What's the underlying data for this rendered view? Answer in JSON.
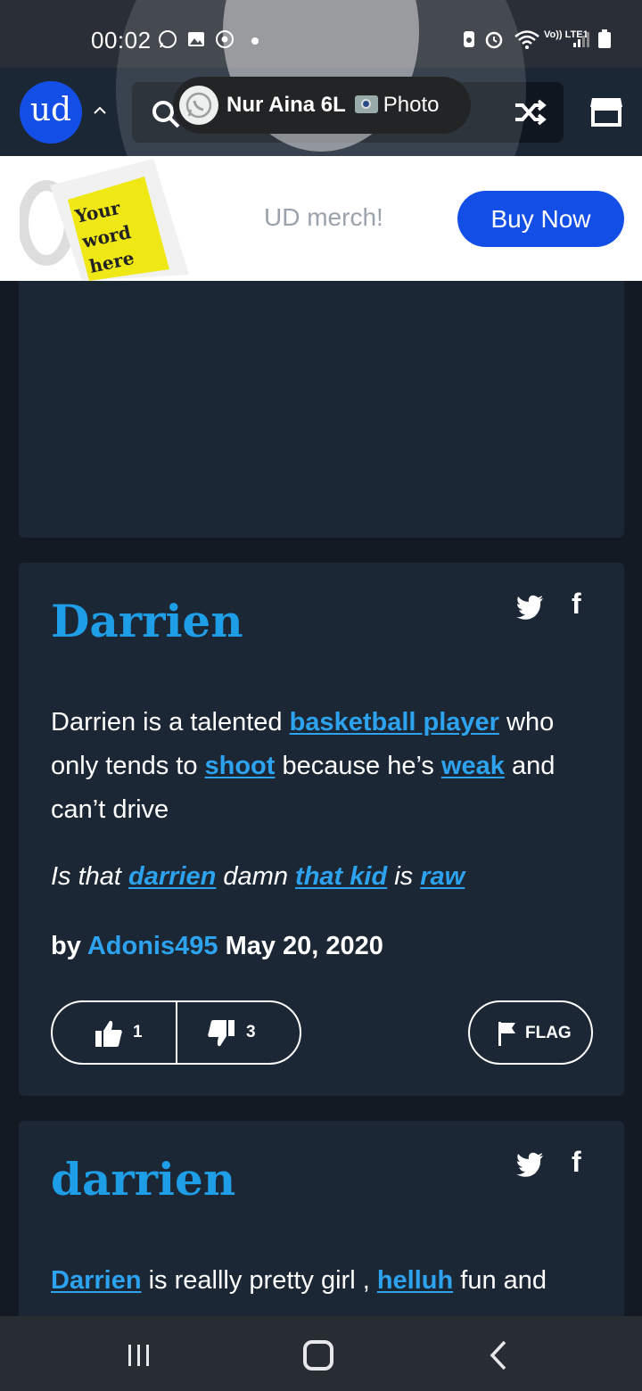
{
  "status_bar": {
    "time": "00:02",
    "icons": [
      "whatsapp-icon",
      "gallery-icon",
      "chrome-icon",
      "dot-icon",
      "battery-saver-icon",
      "alarm-icon",
      "wifi-icon",
      "volte-lte-icon",
      "signal-icon",
      "battery-icon"
    ],
    "network_label": "Vo)) LTE1"
  },
  "navbar": {
    "logo_text": "ud",
    "icons": [
      "chevron-up-icon",
      "search-icon",
      "shuffle-icon",
      "store-icon"
    ]
  },
  "notification": {
    "sender": "Nur Aina 6L",
    "message": "Photo",
    "app_icon": "whatsapp-icon"
  },
  "merch_banner": {
    "mug_text": "Your word here",
    "text": "UD merch!",
    "button_label": "Buy Now",
    "accent": "#134fe6"
  },
  "entries": [
    {
      "word": "Darrien",
      "meaning": [
        {
          "t": "Darrien is a talented "
        },
        {
          "t": "basketball player",
          "link": true
        },
        {
          "t": " who only tends to "
        },
        {
          "t": "shoot",
          "link": true
        },
        {
          "t": " because he’s "
        },
        {
          "t": "weak",
          "link": true
        },
        {
          "t": " and can’t drive"
        }
      ],
      "example": [
        {
          "t": "Is that "
        },
        {
          "t": "darrien",
          "link": true
        },
        {
          "t": " damn "
        },
        {
          "t": "that kid",
          "link": true
        },
        {
          "t": " is "
        },
        {
          "t": "raw",
          "link": true
        }
      ],
      "by_label": "by",
      "author": "Adonis495",
      "date": "May 20, 2020",
      "upvotes": "1",
      "downvotes": "3",
      "flag_label": "FLAG"
    },
    {
      "word": "darrien",
      "meaning": [
        {
          "t": "Darrien",
          "link": true
        },
        {
          "t": " is reallly pretty girl , "
        },
        {
          "t": "helluh",
          "link": true
        },
        {
          "t": " fun and"
        }
      ]
    }
  ],
  "share_icons": [
    "twitter-icon",
    "facebook-icon"
  ],
  "system_nav": [
    "recent-apps-icon",
    "home-icon",
    "back-icon"
  ],
  "colors": {
    "background": "#131a24",
    "card": "#1c2735",
    "title": "#1f9ee8",
    "link": "#2da2ee"
  }
}
